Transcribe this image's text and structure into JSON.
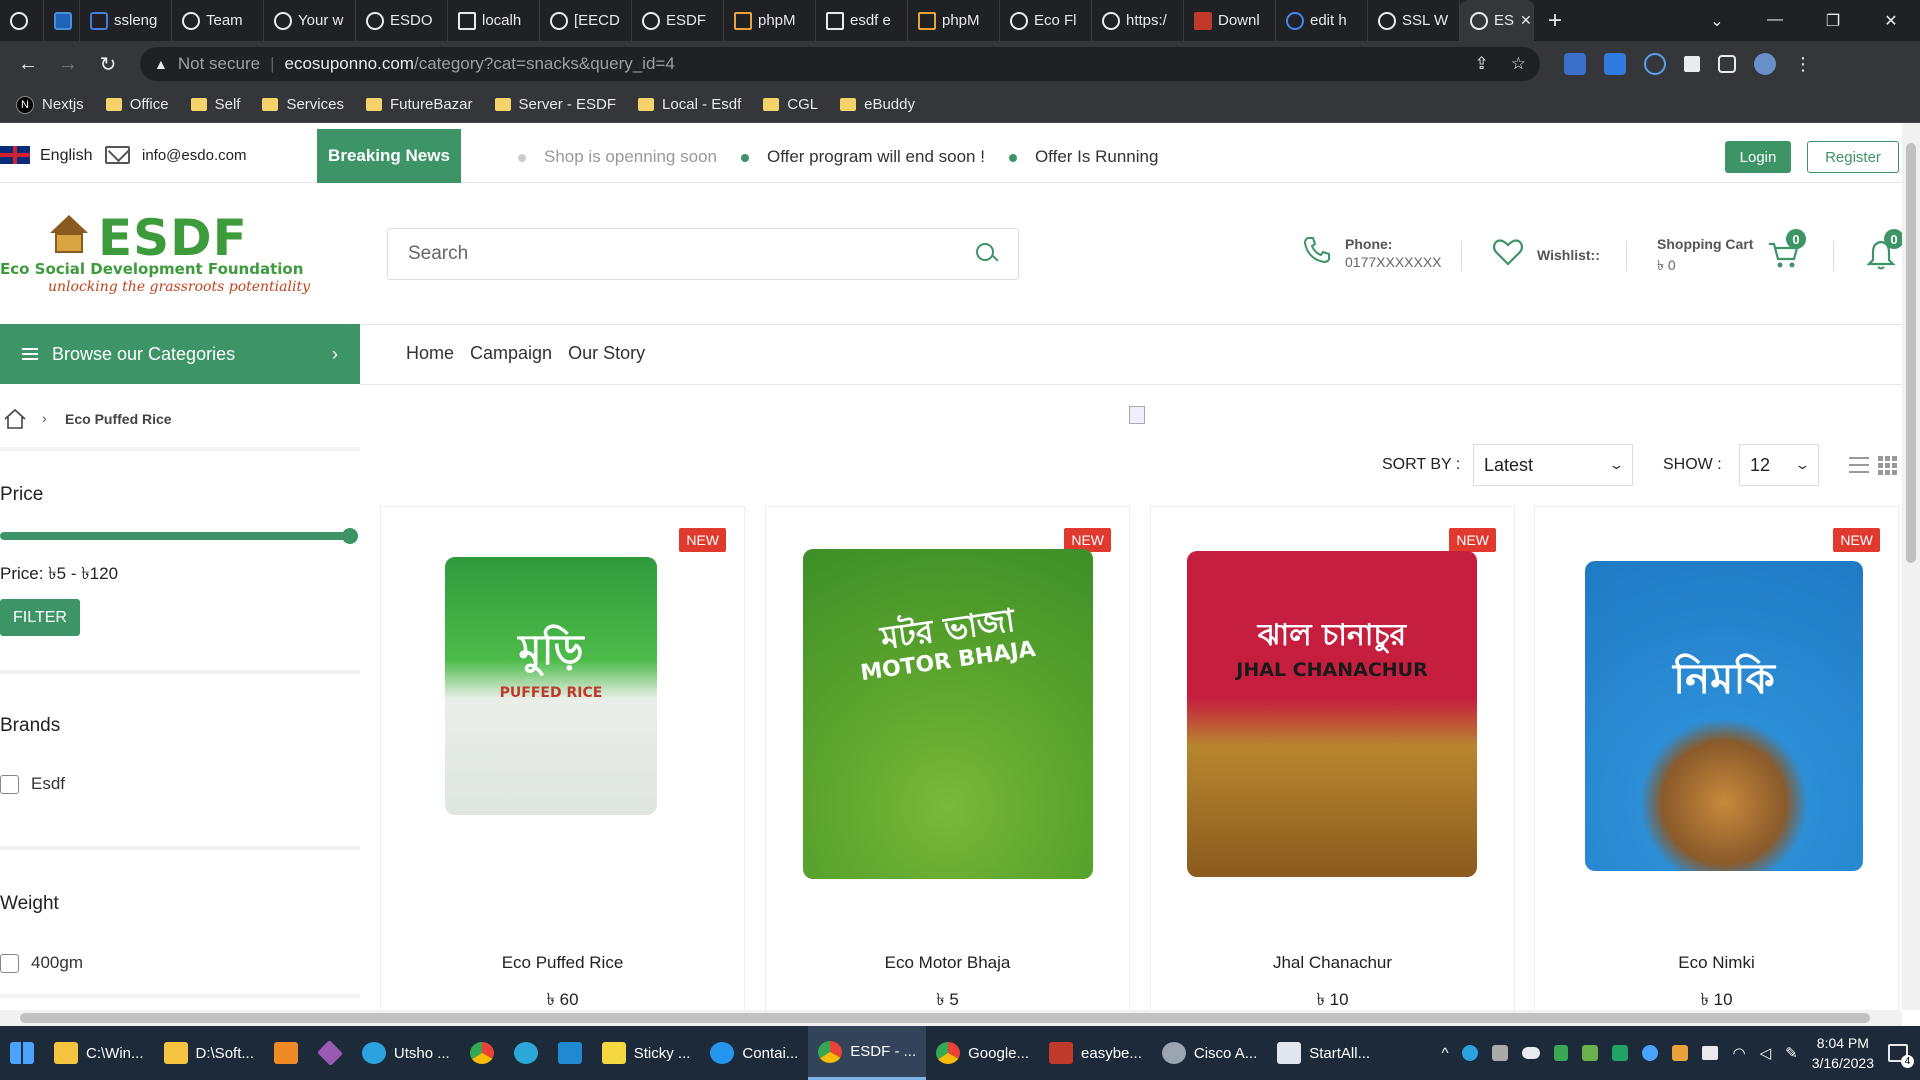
{
  "browser": {
    "tabs": [
      {
        "label": "ssleng",
        "active": false
      },
      {
        "label": "Team",
        "active": false
      },
      {
        "label": "Your w",
        "active": false
      },
      {
        "label": "ESDO",
        "active": false
      },
      {
        "label": "localh",
        "active": false
      },
      {
        "label": "[EECD",
        "active": false
      },
      {
        "label": "ESDF",
        "active": false
      },
      {
        "label": "phpM",
        "active": false
      },
      {
        "label": "esdf e",
        "active": false
      },
      {
        "label": "phpM",
        "active": false
      },
      {
        "label": "Eco Fl",
        "active": false
      },
      {
        "label": "https:/",
        "active": false
      },
      {
        "label": "Downl",
        "active": false
      },
      {
        "label": "edit h",
        "active": false
      },
      {
        "label": "SSL W",
        "active": false
      },
      {
        "label": "ES",
        "active": true
      }
    ],
    "security_label": "Not secure",
    "url_host": "ecosuponno.com",
    "url_path": "/category?cat=snacks&query_id=4",
    "bookmarks": [
      "Nextjs",
      "Office",
      "Self",
      "Services",
      "FutureBazar",
      "Server - ESDF",
      "Local - Esdf",
      "CGL",
      "eBuddy"
    ]
  },
  "topbar": {
    "language": "English",
    "email": "info@esdo.com",
    "breaking_label": "Breaking News",
    "ticker": [
      "Shop is openning soon",
      "Offer program will end soon !",
      "Offer Is Running"
    ],
    "login_label": "Login",
    "register_label": "Register"
  },
  "header": {
    "logo_text": "ESDF",
    "logo_subtitle": "Eco Social Development Foundation",
    "logo_tagline": "unlocking the grassroots potentiality",
    "search_placeholder": "Search",
    "phone_label": "Phone:",
    "phone_number": "0177XXXXXXX",
    "wishlist_label": "Wishlist::",
    "cart_label": "Shopping Cart",
    "cart_total": "৳ 0",
    "cart_count": "0",
    "notification_count": "0"
  },
  "nav": {
    "browse_label": "Browse our Categories",
    "links": [
      "Home",
      "Campaign",
      "Our Story"
    ]
  },
  "sidebar": {
    "breadcrumb": "Eco Puffed Rice",
    "price_title": "Price",
    "price_range": "Price: ৳5 - ৳120",
    "filter_label": "FILTER",
    "brands_title": "Brands",
    "brands": [
      "Esdf"
    ],
    "weight_title": "Weight",
    "weights": [
      "400gm"
    ]
  },
  "toolbar": {
    "sort_label": "SORT BY :",
    "sort_value": "Latest",
    "show_label": "SHOW :",
    "show_value": "12"
  },
  "products": [
    {
      "badge": "NEW",
      "name": "Eco Puffed Rice",
      "price": "৳ 60",
      "pack_text": "মুড়ি",
      "pack_sub": "PUFFED RICE"
    },
    {
      "badge": "NEW",
      "name": "Eco Motor Bhaja",
      "price": "৳ 5",
      "pack_text": "মটর ভাজা",
      "pack_sub": "MOTOR BHAJA"
    },
    {
      "badge": "NEW",
      "name": "Jhal Chanachur",
      "price": "৳ 10",
      "pack_text": "ঝাল চানাচুর",
      "pack_sub": "JHAL CHANACHUR"
    },
    {
      "badge": "NEW",
      "name": "Eco Nimki",
      "price": "৳ 10",
      "pack_text": "নিমকি",
      "pack_sub": ""
    }
  ],
  "taskbar": {
    "items": [
      "C:\\Win...",
      "D:\\Soft...",
      "Utsho ...",
      "Sticky ...",
      "Contai...",
      "ESDF - ...",
      "Google...",
      "easybe...",
      "Cisco A...",
      "StartAll..."
    ],
    "time": "8:04 PM",
    "date": "3/16/2023",
    "notification_count": "4"
  },
  "colors": {
    "brand_green": "#3d9466",
    "new_badge": "#e03a2f",
    "logo_green": "#3d9b3c"
  }
}
